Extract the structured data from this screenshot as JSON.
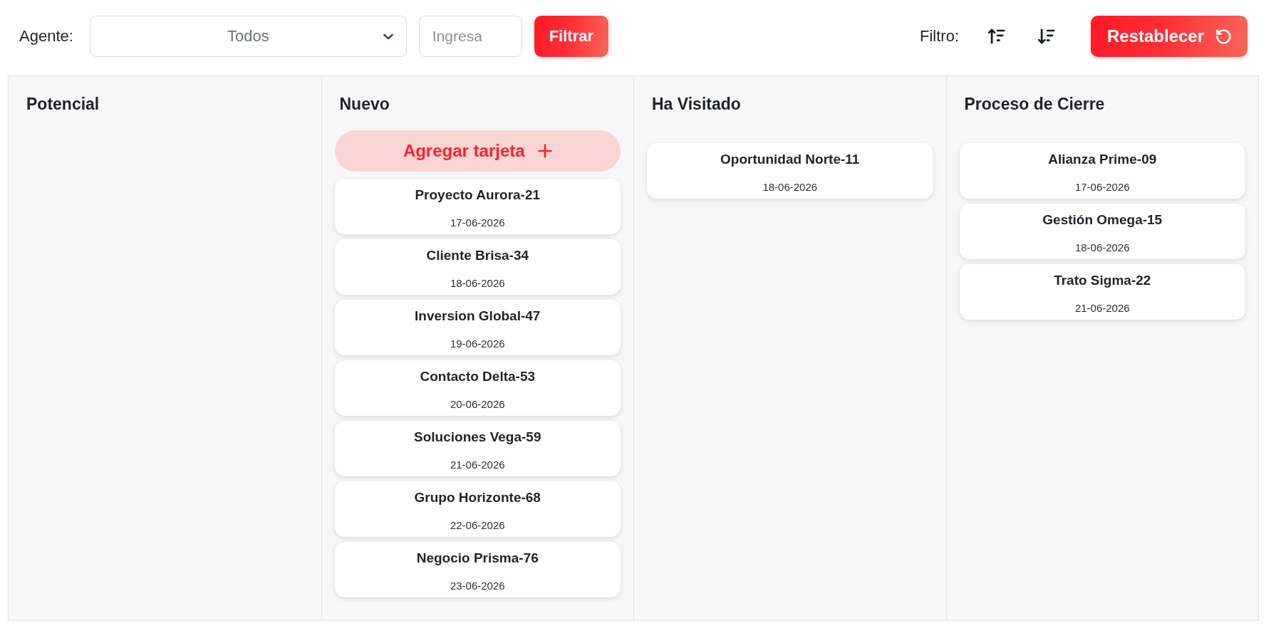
{
  "toolbar": {
    "agent_label": "Agente:",
    "agent_select": {
      "value": "Todos"
    },
    "search": {
      "placeholder": "Ingresa"
    },
    "filter_button": {
      "label": "Filtrar"
    },
    "sort_label": "Filtro:",
    "reset_button": {
      "label": "Restablecer"
    }
  },
  "board": {
    "columns": [
      {
        "title": "Potencial"
      },
      {
        "title": "Nuevo",
        "add_button": {
          "label": "Agregar tarjeta"
        },
        "cards": [
          {
            "title": "Proyecto Aurora-21",
            "date": "17-06-2026"
          },
          {
            "title": "Cliente Brisa-34",
            "date": "18-06-2026"
          },
          {
            "title": "Inversion Global-47",
            "date": "19-06-2026"
          },
          {
            "title": "Contacto Delta-53",
            "date": "20-06-2026"
          },
          {
            "title": "Soluciones Vega-59",
            "date": "21-06-2026"
          },
          {
            "title": "Grupo Horizonte-68",
            "date": "22-06-2026"
          },
          {
            "title": "Negocio Prisma-76",
            "date": "23-06-2026"
          }
        ]
      },
      {
        "title": "Ha Visitado",
        "cards": [
          {
            "title": "Oportunidad Norte-11",
            "date": "18-06-2026"
          }
        ]
      },
      {
        "title": "Proceso de Cierre",
        "cards": [
          {
            "title": "Alianza Prime-09",
            "date": "17-06-2026"
          },
          {
            "title": "Gestión Omega-15",
            "date": "18-06-2026"
          },
          {
            "title": "Trato Sigma-22",
            "date": "21-06-2026"
          }
        ]
      }
    ]
  }
}
